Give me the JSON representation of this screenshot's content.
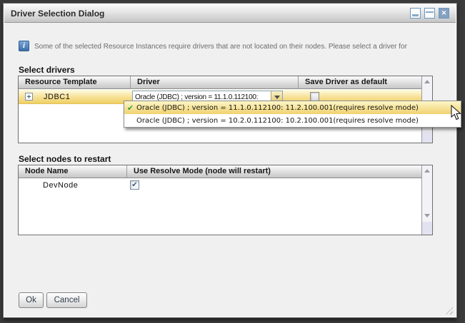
{
  "window": {
    "title": "Driver Selection Dialog",
    "controls": {
      "minimize": "minimize",
      "restore": "restore",
      "close": "close"
    }
  },
  "info_banner": {
    "message": "Some of the selected Resource Instances require drivers that are not located on their nodes. Please select a driver for"
  },
  "drivers_section": {
    "label": "Select drivers",
    "columns": [
      "Resource Template",
      "Driver",
      "Save Driver as default"
    ],
    "row": {
      "resource_template": "JDBC1",
      "driver_selected": "Oracle (JDBC) ; version = 11.1.0.112100:",
      "save_as_default_checked": false
    }
  },
  "driver_dropdown": {
    "options": [
      {
        "label": "Oracle (JDBC) ; version = 11.1.0.112100: 11.2.100.001(requires resolve mode)",
        "selected": true
      },
      {
        "label": "Oracle (JDBC) ; version = 10.2.0.112100: 10.2.100.001(requires resolve mode)",
        "selected": false
      }
    ]
  },
  "nodes_section": {
    "label": "Select nodes to restart",
    "columns": [
      "Node Name",
      "Use Resolve Mode (node will restart)"
    ],
    "row": {
      "node_name": "DevNode",
      "use_resolve_mode_checked": true
    }
  },
  "footer": {
    "ok": "Ok",
    "cancel": "Cancel"
  },
  "colors": {
    "selection_yellow": "#f3d87c",
    "header_gradient_gray": "#c6c6c6",
    "info_icon_blue": "#3c6ea9",
    "check_green": "#2f9e38",
    "dialog_bg": "#f0f0f0",
    "backdrop": "#3b3b3b"
  }
}
